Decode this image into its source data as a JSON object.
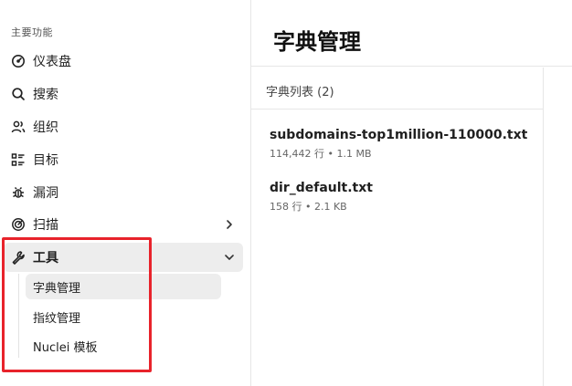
{
  "sidebar": {
    "section_label": "主要功能",
    "items": [
      {
        "label": "仪表盘",
        "icon": "dashboard-gauge-icon"
      },
      {
        "label": "搜索",
        "icon": "search-icon"
      },
      {
        "label": "组织",
        "icon": "users-icon"
      },
      {
        "label": "目标",
        "icon": "target-list-icon"
      },
      {
        "label": "漏洞",
        "icon": "bug-icon"
      },
      {
        "label": "扫描",
        "icon": "scan-icon"
      },
      {
        "label": "工具",
        "icon": "wrench-icon"
      }
    ],
    "tools_subitems": [
      {
        "label": "字典管理"
      },
      {
        "label": "指纹管理"
      },
      {
        "label": "Nuclei 模板"
      }
    ],
    "active_item": "工具",
    "active_subitem": "字典管理"
  },
  "main": {
    "title": "字典管理",
    "list_title": "字典列表 (2)",
    "files": [
      {
        "name": "subdomains-top1million-110000.txt",
        "meta": "114,442 行 • 1.1 MB"
      },
      {
        "name": "dir_default.txt",
        "meta": "158 行 • 2.1 KB"
      }
    ]
  },
  "colors": {
    "highlight_border": "#e8232b",
    "active_bg": "#ededed",
    "divider": "#e6e6e6"
  }
}
